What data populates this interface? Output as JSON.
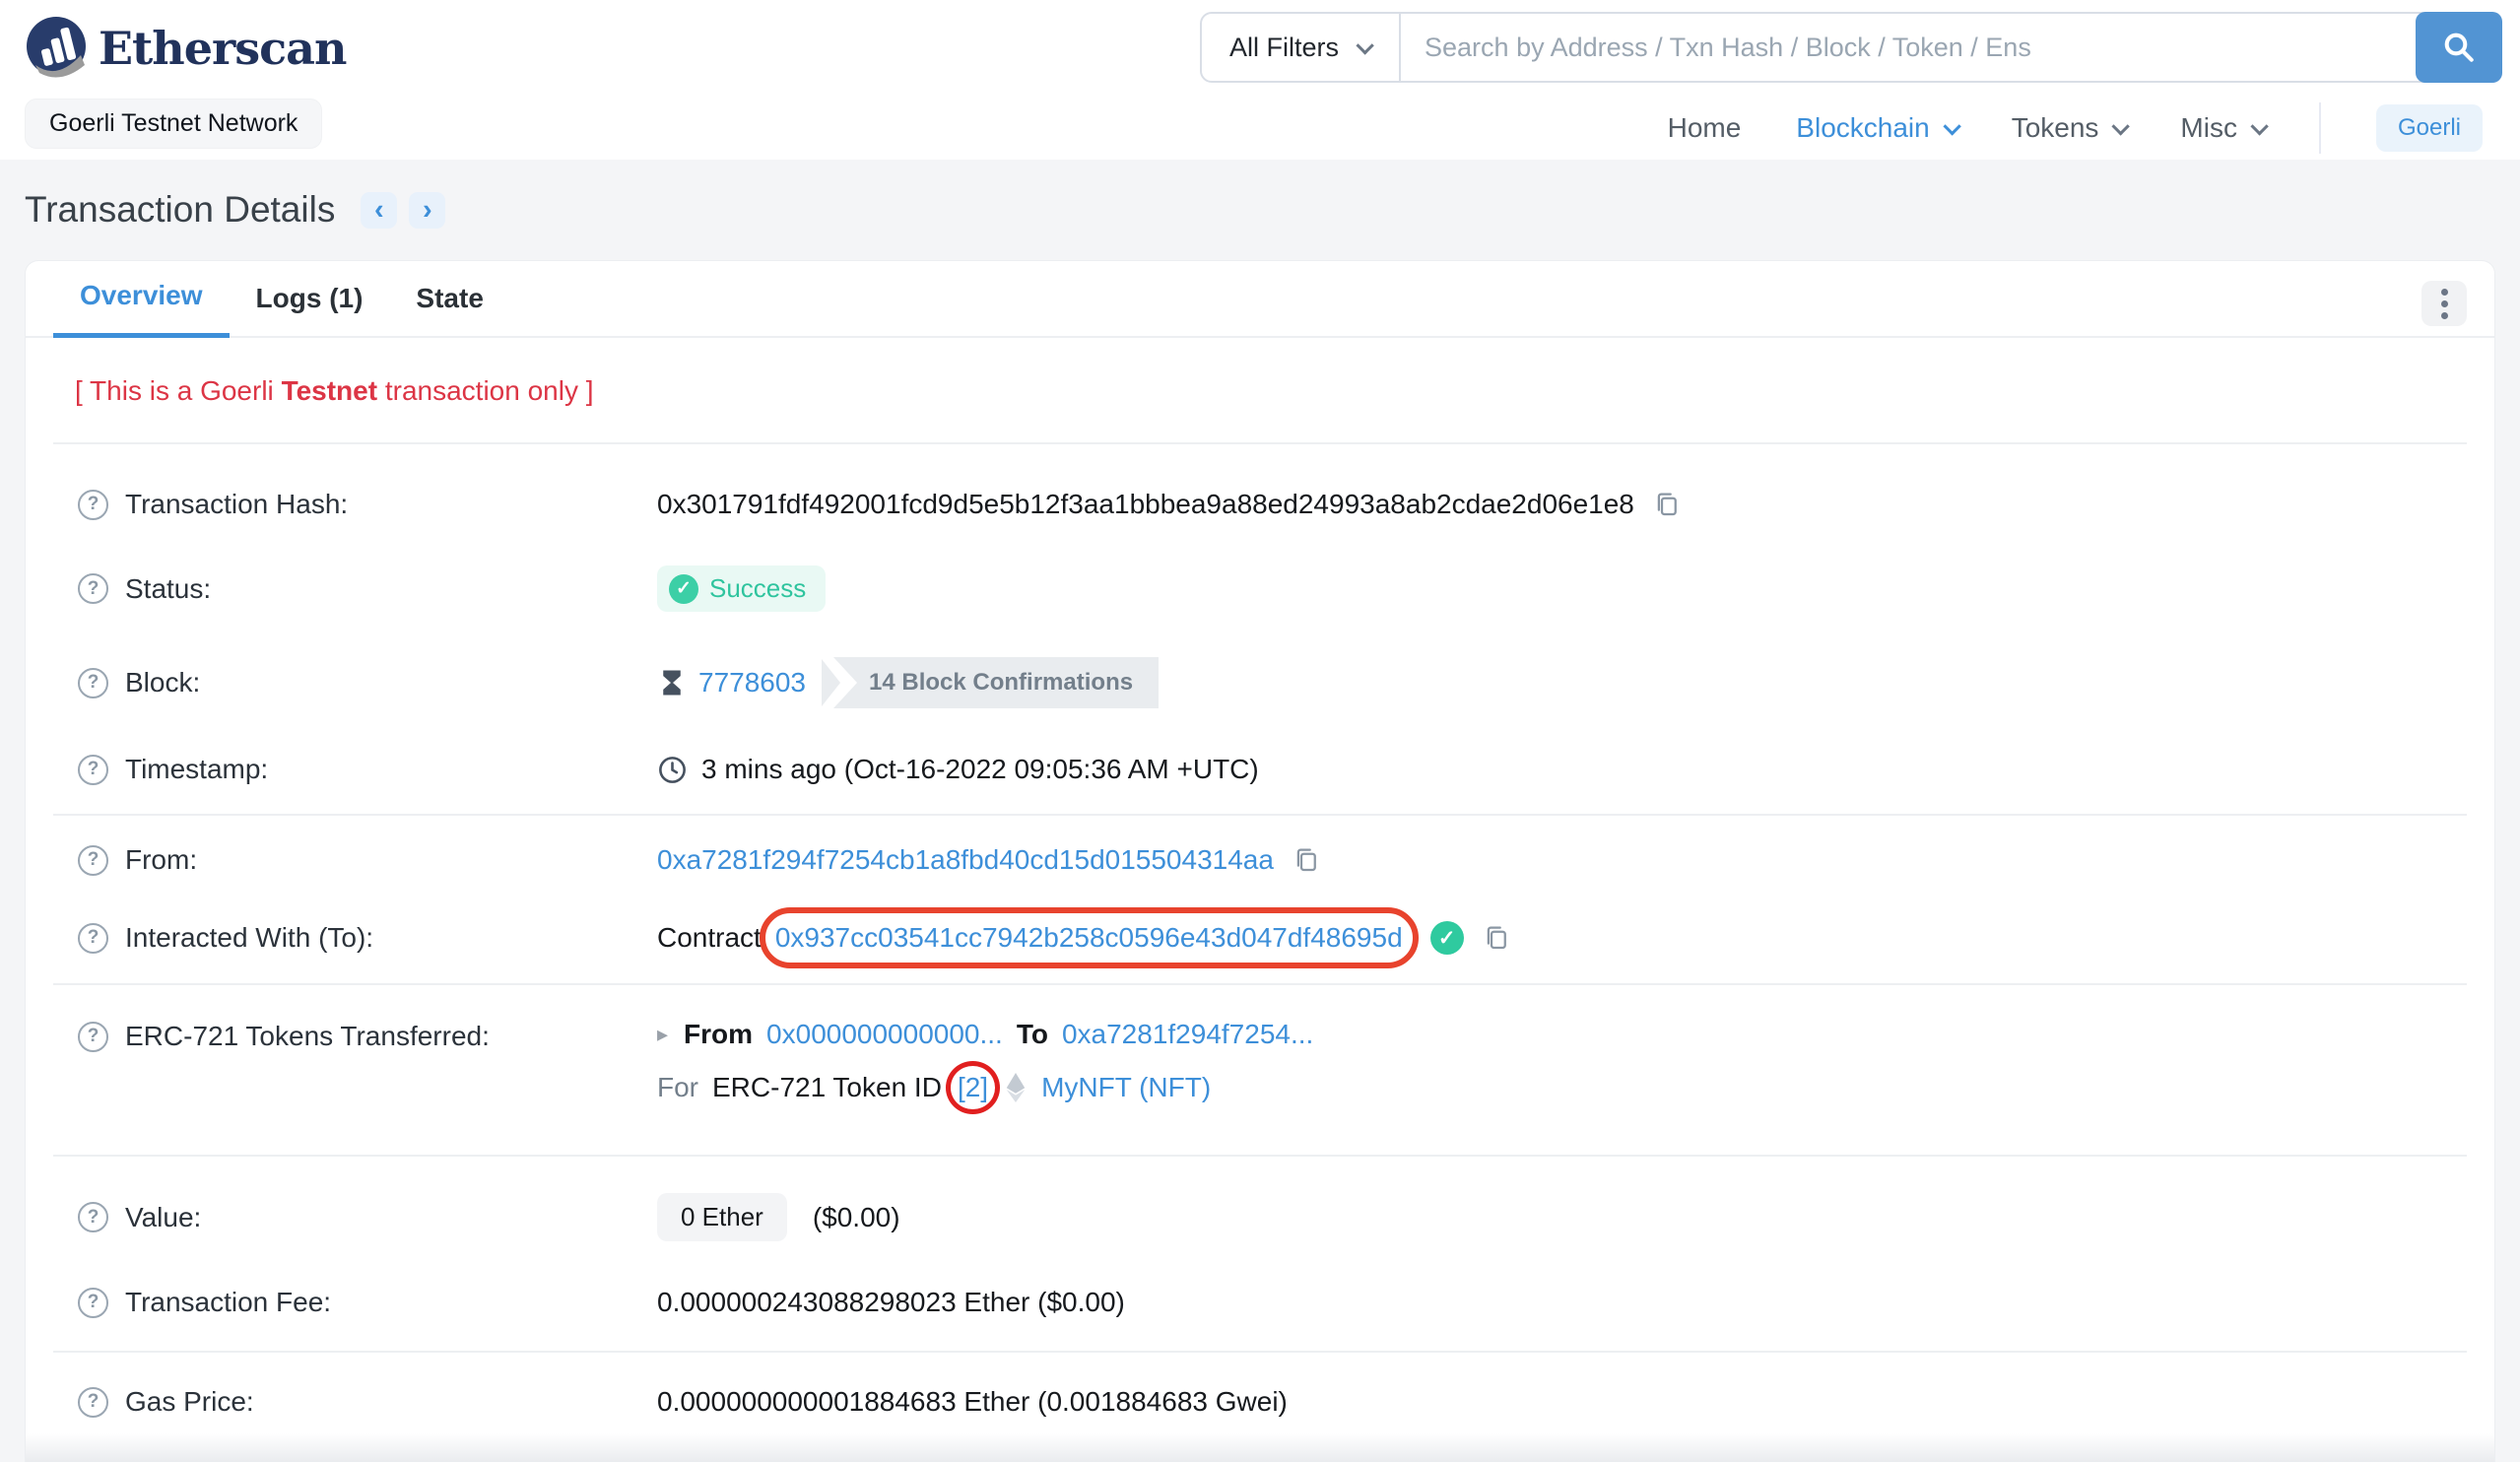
{
  "header": {
    "logo_text": "Etherscan",
    "network_badge": "Goerli Testnet Network",
    "search": {
      "filter_label": "All Filters",
      "placeholder": "Search by Address / Txn Hash / Block / Token / Ens"
    },
    "nav": {
      "home": "Home",
      "blockchain": "Blockchain",
      "tokens": "Tokens",
      "misc": "Misc",
      "network_button": "Goerli"
    }
  },
  "page": {
    "title": "Transaction Details",
    "prev_arrow": "‹",
    "next_arrow": "›",
    "tabs": {
      "overview": "Overview",
      "logs": "Logs (1)",
      "state": "State"
    }
  },
  "warning": {
    "prefix": "[ This is a Goerli ",
    "bold": "Testnet",
    "suffix": " transaction only ]"
  },
  "icons": {
    "help": "?",
    "check": "✓"
  },
  "rows": {
    "transaction_hash": {
      "label": "Transaction Hash:",
      "value": "0x301791fdf492001fcd9d5e5b12f3aa1bbbea9a88ed24993a8ab2cdae2d06e1e8"
    },
    "status": {
      "label": "Status:",
      "value": "Success"
    },
    "block": {
      "label": "Block:",
      "number": "7778603",
      "confirmations": "14 Block Confirmations"
    },
    "timestamp": {
      "label": "Timestamp:",
      "value": "3 mins ago (Oct-16-2022 09:05:36 AM +UTC)"
    },
    "from": {
      "label": "From:",
      "address": "0xa7281f294f7254cb1a8fbd40cd15d015504314aa"
    },
    "interacted_with": {
      "label": "Interacted With (To):",
      "prefix": "Contract",
      "address": "0x937cc03541cc7942b258c0596e43d047df48695d"
    },
    "erc721": {
      "label": "ERC-721 Tokens Transferred:",
      "arrow": "▸",
      "from_label": "From",
      "from_address": "0x000000000000...",
      "to_label": "To",
      "to_address": "0xa7281f294f7254...",
      "for_label": "For",
      "token_id_label": "ERC-721 Token ID",
      "token_id": "[2]",
      "token_name": "MyNFT (NFT)"
    },
    "value": {
      "label": "Value:",
      "badge": "0 Ether",
      "usd": "($0.00)"
    },
    "transaction_fee": {
      "label": "Transaction Fee:",
      "value": "0.000000243088298023 Ether ($0.00)"
    },
    "gas_price": {
      "label": "Gas Price:",
      "value": "0.000000000001884683 Ether (0.001884683 Gwei)"
    }
  },
  "colors": {
    "link_blue": "#3d8fd9",
    "button_blue": "#5294d3",
    "logo_navy": "#21325b",
    "warning_red": "#dc3545",
    "annotation_red": "#e8432d",
    "success_green": "#2fc49e",
    "badge_gray": "#e9ecef"
  }
}
